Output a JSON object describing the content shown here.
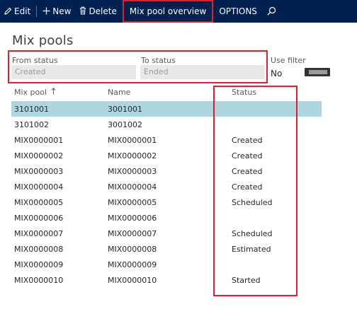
{
  "toolbar": {
    "edit_label": "Edit",
    "new_label": "New",
    "delete_label": "Delete",
    "overview_label": "Mix pool overview",
    "options_label": "OPTIONS"
  },
  "page": {
    "title": "Mix pools"
  },
  "filters": {
    "from_status_label": "From status",
    "from_status_value": "Created",
    "to_status_label": "To status",
    "to_status_value": "Ended",
    "use_filter_label": "Use filter",
    "use_filter_value": "No"
  },
  "grid": {
    "columns": {
      "mix_pool": "Mix pool",
      "name": "Name",
      "status": "Status"
    },
    "rows": [
      {
        "mix_pool": "3101001",
        "name": "3001001",
        "status": ""
      },
      {
        "mix_pool": "3101002",
        "name": "3001002",
        "status": ""
      },
      {
        "mix_pool": "MIX0000001",
        "name": "MIX0000001",
        "status": "Created"
      },
      {
        "mix_pool": "MIX0000002",
        "name": "MIX0000002",
        "status": "Created"
      },
      {
        "mix_pool": "MIX0000003",
        "name": "MIX0000003",
        "status": "Created"
      },
      {
        "mix_pool": "MIX0000004",
        "name": "MIX0000004",
        "status": "Created"
      },
      {
        "mix_pool": "MIX0000005",
        "name": "MIX0000005",
        "status": "Scheduled"
      },
      {
        "mix_pool": "MIX0000006",
        "name": "MIX0000006",
        "status": ""
      },
      {
        "mix_pool": "MIX0000007",
        "name": "MIX0000007",
        "status": "Scheduled"
      },
      {
        "mix_pool": "MIX0000008",
        "name": "MIX0000008",
        "status": "Estimated"
      },
      {
        "mix_pool": "MIX0000009",
        "name": "MIX0000009",
        "status": ""
      },
      {
        "mix_pool": "MIX0000010",
        "name": "MIX0000010",
        "status": "Started"
      }
    ]
  },
  "colors": {
    "toolbar_bg": "#002050",
    "selected_row": "#aed6de",
    "annotation_red": "#e0202a"
  },
  "icons": {
    "edit": "pencil-icon",
    "new": "plus-icon",
    "delete": "trash-icon",
    "search": "search-icon",
    "sort": "sort-ascending-icon"
  }
}
